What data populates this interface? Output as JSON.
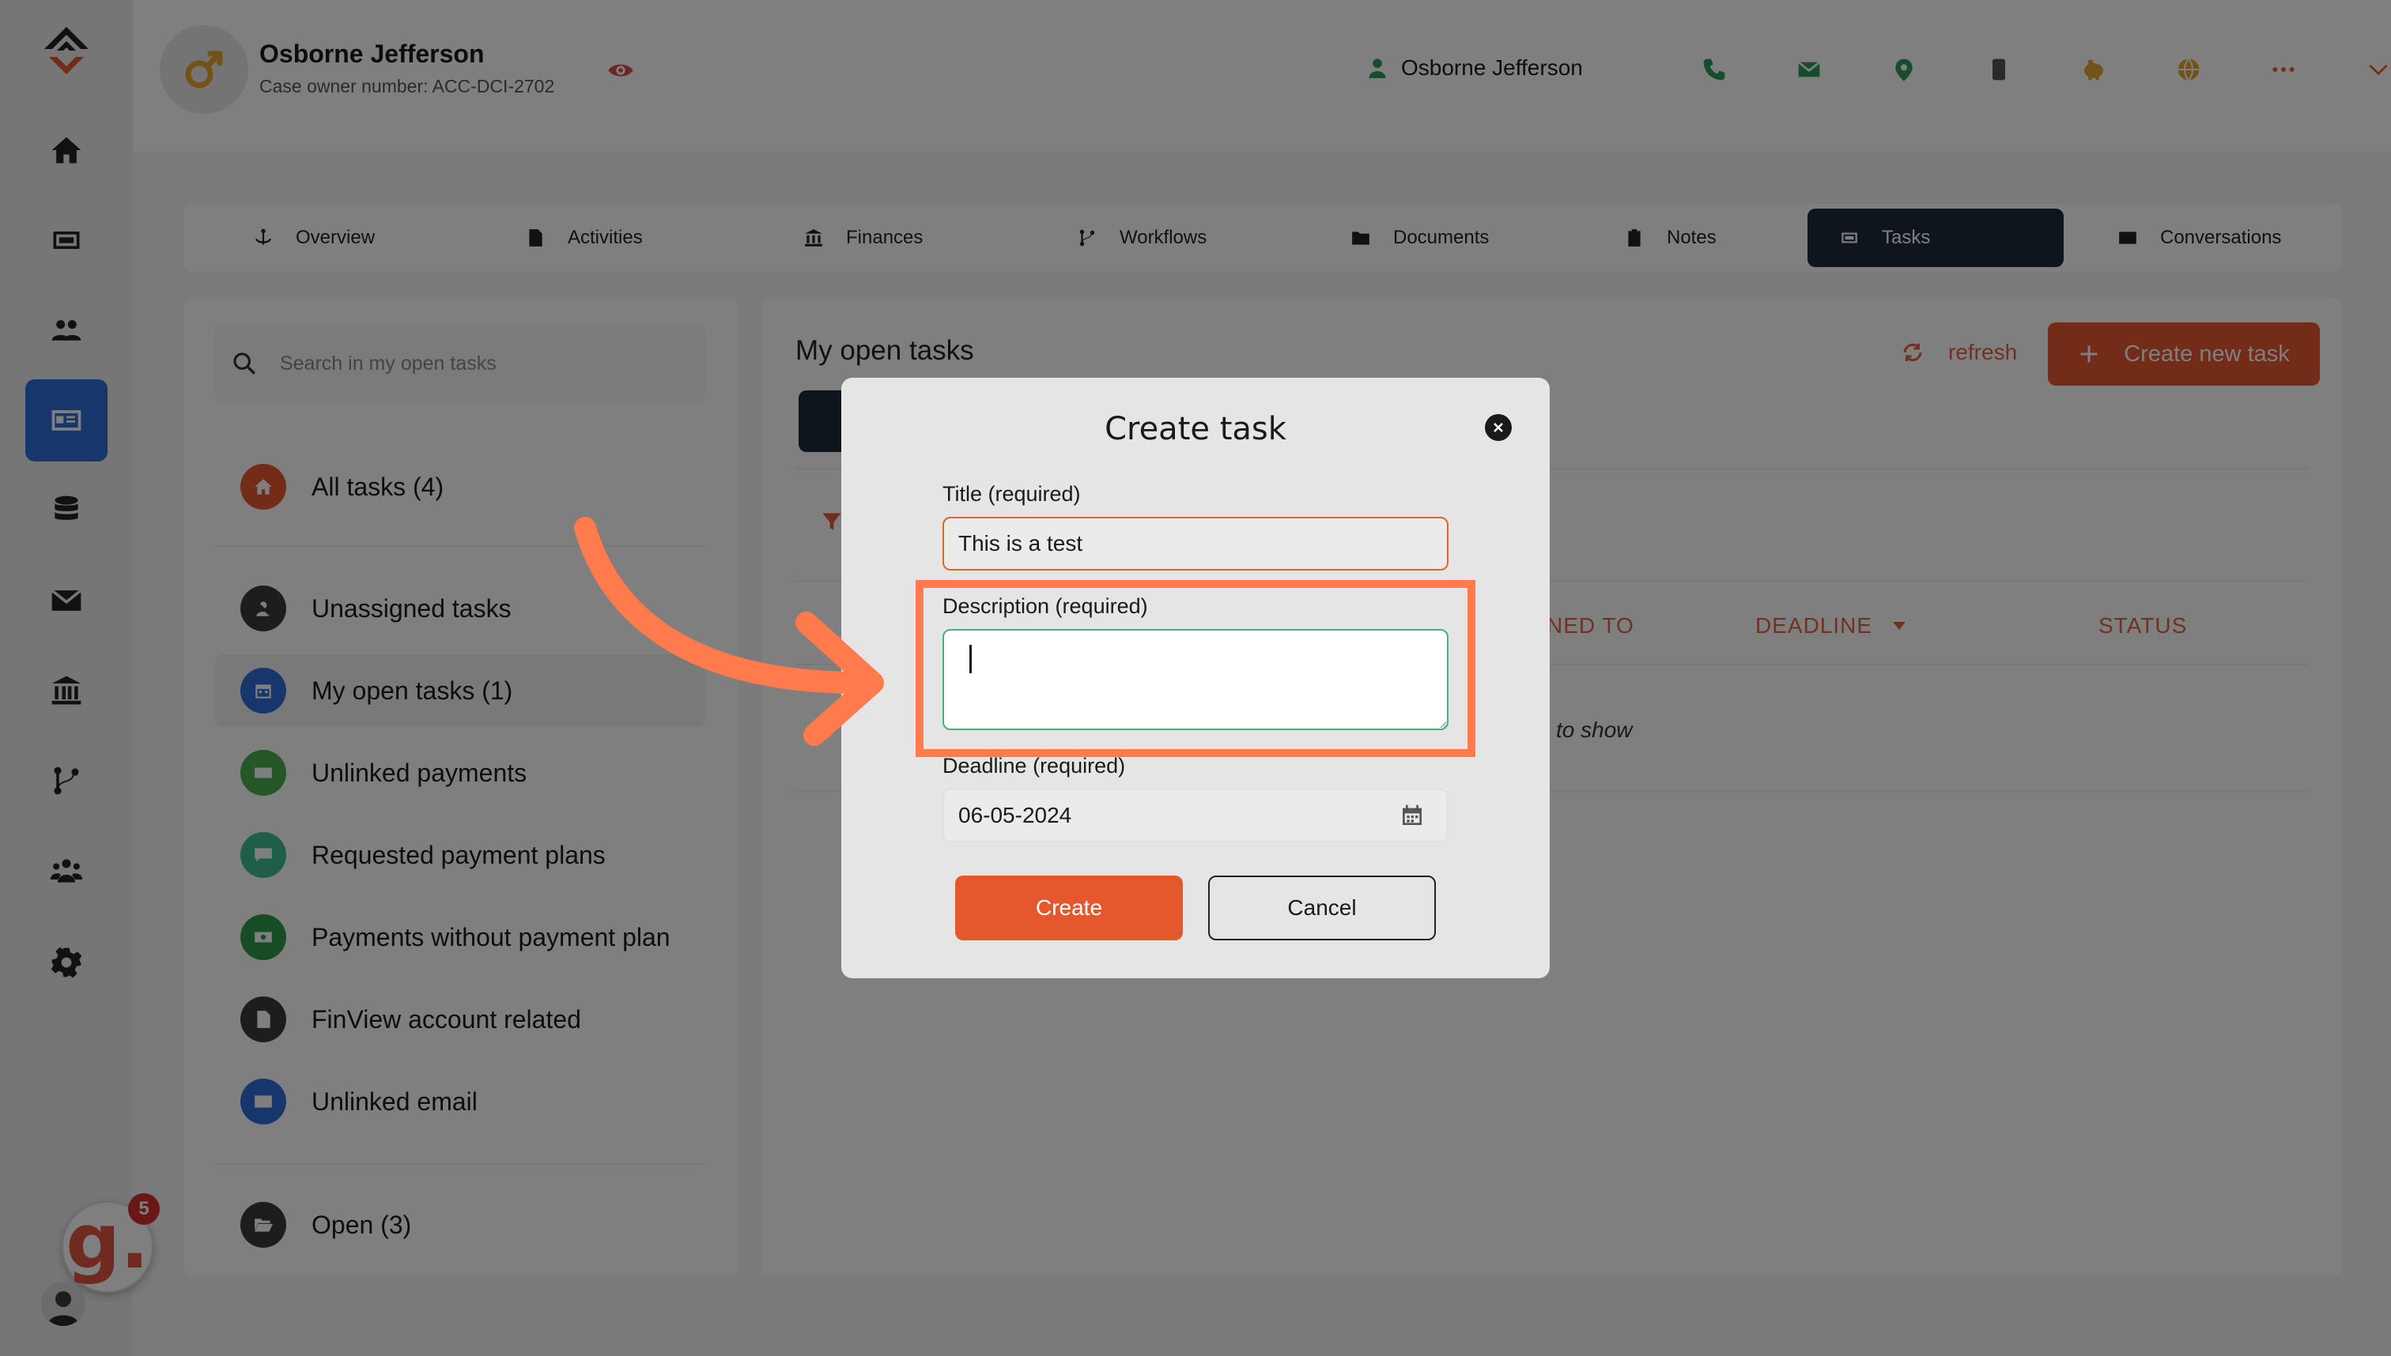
{
  "header": {
    "owner_name": "Osborne Jefferson",
    "owner_sub": "Case owner number: ACC-DCI-2702",
    "user_name": "Osborne Jefferson",
    "icons": [
      "phone-icon",
      "mail-icon",
      "location-icon",
      "mobile-icon",
      "piggy-bank-icon",
      "globe-icon",
      "more-icon",
      "chevron-down-icon"
    ]
  },
  "tabs": [
    {
      "label": "Overview"
    },
    {
      "label": "Activities"
    },
    {
      "label": "Finances"
    },
    {
      "label": "Workflows"
    },
    {
      "label": "Documents"
    },
    {
      "label": "Notes"
    },
    {
      "label": "Tasks"
    },
    {
      "label": "Conversations"
    }
  ],
  "active_tab": "Tasks",
  "sidebar": {
    "items": [
      "home",
      "inbox",
      "users",
      "cases",
      "database",
      "mail",
      "bank",
      "workflows",
      "team",
      "settings"
    ],
    "active": "cases",
    "badge_letter": "g.",
    "badge_count": "5"
  },
  "left_panel": {
    "search_placeholder": "Search in my open tasks",
    "categories": [
      {
        "label": "All tasks (4)",
        "color": "#e5582e"
      },
      {
        "label": "Unassigned tasks",
        "color": "#3a3a3a"
      },
      {
        "label": "My open tasks (1)",
        "color": "#2f6ed8"
      },
      {
        "label": "Unlinked payments",
        "color": "#4caf50"
      },
      {
        "label": "Requested payment plans",
        "color": "#3fbf8f"
      },
      {
        "label": "Payments without payment plan",
        "color": "#2e9a4a"
      },
      {
        "label": "FinView account related",
        "color": "#3a3a3a"
      },
      {
        "label": "Unlinked email",
        "color": "#2f6ed8"
      },
      {
        "label": "Open (3)",
        "color": "#3a3a3a"
      }
    ]
  },
  "main": {
    "title": "My open tasks",
    "refresh_label": "refresh",
    "create_label": "Create new task",
    "columns": [
      "NED TO",
      "DEADLINE",
      "STATUS"
    ],
    "empty_text": "to show"
  },
  "modal": {
    "title": "Create task",
    "title_label": "Title (required)",
    "title_value": "This is a test",
    "description_label": "Description (required)",
    "description_value": "",
    "deadline_label": "Deadline (required)",
    "deadline_value": "06-05-2024",
    "create_label": "Create",
    "cancel_label": "Cancel"
  },
  "colors": {
    "accent": "#e5582e",
    "active_tab": "#1f2a3a",
    "highlight": "#ff7a4d",
    "focus": "#4caf7a"
  }
}
